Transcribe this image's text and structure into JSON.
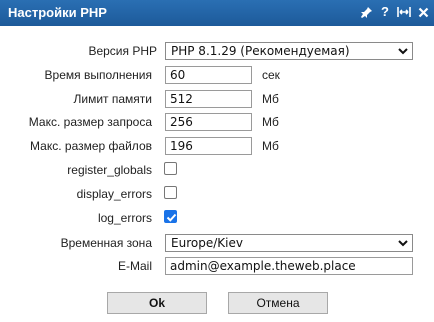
{
  "window": {
    "title": "Настройки PHP"
  },
  "titlebar_icons": [
    "pin-icon",
    "help-icon",
    "resize-icon",
    "close-icon"
  ],
  "fields": {
    "php_version": {
      "label": "Версия PHP",
      "selected": "PHP 8.1.29 (Рекомендуемая)"
    },
    "exec_time": {
      "label": "Время выполнения",
      "value": "60",
      "unit": "сек"
    },
    "memory_limit": {
      "label": "Лимит памяти",
      "value": "512",
      "unit": "Мб"
    },
    "max_request": {
      "label": "Макс. размер запроса",
      "value": "256",
      "unit": "Мб"
    },
    "max_file": {
      "label": "Макс. размер файлов",
      "value": "196",
      "unit": "Мб"
    },
    "register_globals": {
      "label": "register_globals",
      "checked": false
    },
    "display_errors": {
      "label": "display_errors",
      "checked": false
    },
    "log_errors": {
      "label": "log_errors",
      "checked": true
    },
    "timezone": {
      "label": "Временная зона",
      "selected": "Europe/Kiev"
    },
    "email": {
      "label": "E-Mail",
      "value": "admin@example.theweb.place"
    }
  },
  "buttons": {
    "ok": "Ok",
    "cancel": "Отмена"
  },
  "colors": {
    "titlebar": "#1d5a9a",
    "checkbox_checked": "#1a73e8"
  }
}
